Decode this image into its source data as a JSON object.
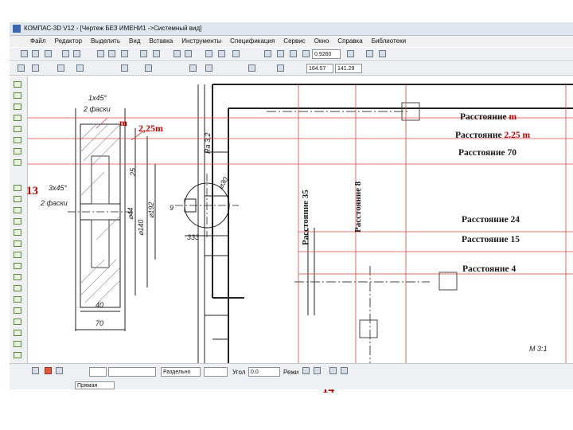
{
  "window": {
    "title": "КОМПАС-3D V12 - [Чертеж БЕЗ ИМЕНИ1 ->Системный вид]"
  },
  "menu": {
    "items": [
      "Файл",
      "Редактор",
      "Выделить",
      "Вид",
      "Вставка",
      "Инструменты",
      "Спецификация",
      "Сервис",
      "Окно",
      "Справка",
      "Библиотеки"
    ]
  },
  "toolbar": {
    "zoom_value": "0.9260",
    "coord_x": "164.57",
    "coord_y": "141.29"
  },
  "properties_panel": {
    "mode_value": "Раздельно",
    "angle_label": "Угол",
    "angle_value": "0.0",
    "regime_label": "Режи",
    "tab_label": "Прямая"
  },
  "drawing": {
    "note_scale": "М 3:1",
    "dims": {
      "chamfer_top": "1x45°",
      "chamfer_top_note": "2 фаски",
      "chamfer_mid": "3x45°",
      "chamfer_mid_note": "2 фаски",
      "width_40": "40",
      "width_70": "70",
      "d_192": "⌀192",
      "d_140": "⌀140",
      "d_44": "⌀44",
      "d_30": "⌀30",
      "hub_333": "333",
      "key_9": "9",
      "r_25": "25",
      "module_m": "m",
      "module_225": "2,25m",
      "rough": "Ra 3,2"
    }
  },
  "annotations": {
    "dist_m_label": "Расстояние",
    "dist_m_value": "m",
    "dist_225_label": "Расстояние",
    "dist_225_value": "2.25 m",
    "dist_70": "Расстояние  70",
    "dist_24": "Расстояние 24",
    "dist_15": "Расстояние 15",
    "dist_4": "Расстояние 4",
    "dist_35": "Расстояние 35",
    "dist_8": "Расстояние 8",
    "num_13": "13",
    "num_14": "14",
    "hand_m": "m",
    "hand_225": "2,25m"
  }
}
